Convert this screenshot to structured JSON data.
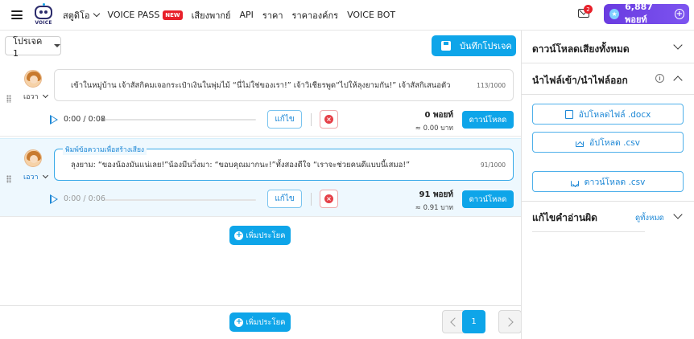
{
  "app": {
    "logo_text": "VOICE"
  },
  "nav": {
    "studio": "สตูดิโอ",
    "voice_pass": "VOICE PASS",
    "new_badge": "NEW",
    "voice_actor": "เสียงพากย์",
    "api": "API",
    "price": "ราคา",
    "org_price": "ราคาองค์กร",
    "voice_bot": "VOICE BOT"
  },
  "header": {
    "notification_count": "2",
    "points_label": "6,887 พอยท์"
  },
  "toolbar": {
    "project": "โปรเจค 1",
    "save_label": "บันทึกโปรเจค"
  },
  "sentences": [
    {
      "voice": "เอวา",
      "text": "เข้าในหมู่บ้าน เจ้าสัสกิคมเจอกระเป๋าเงินในพุ่มไม้ “นี่ไม่ใช่ของเรา!” เจ้าวิเชียรพูด“ไปให้ลุงยามกัน!” เจ้าสัสกิเสนอตัว",
      "counter": "113/1000",
      "time": "0:00 / 0:08",
      "edit_label": "แก้ไข",
      "points": "0 พอยท์",
      "baht": "≈ 0.00 บาท",
      "download_label": "ดาวน์โหลด"
    },
    {
      "voice": "เอวา",
      "legend": "พิมพ์ข้อความเพื่อสร้างเสียง",
      "text": "ลุงยาม: “ของน้องมันแน่เลย!”น้องมีนวิ่งมา: “ขอบคุณมากนะ!”ทั้งสองดีใจ “เราจะช่วยคนดีแบบนี้เสมอ!”",
      "counter": "91/1000",
      "time": "0:00 / 0:06",
      "edit_label": "แก้ไข",
      "points": "91 พอยท์",
      "baht": "≈ 0.91 บาท",
      "download_label": "ดาวน์โหลด"
    }
  ],
  "add_sentence_label": "เพิ่มประโยค",
  "pagination": {
    "current": "1"
  },
  "right_panel": {
    "download_all": "ดาวน์โหลดเสียงทั้งหมด",
    "import_export": "นำไฟล์เข้า/นำไฟล์ออก",
    "upload_docx": "อัปโหลดไฟล์ .docx",
    "upload_csv": "อัปโหลด .csv",
    "download_csv": "ดาวน์โหลด .csv",
    "fix_misread": "แก้ไขคำอ่านผิด",
    "see_all": "ดูทั้งหมด"
  }
}
